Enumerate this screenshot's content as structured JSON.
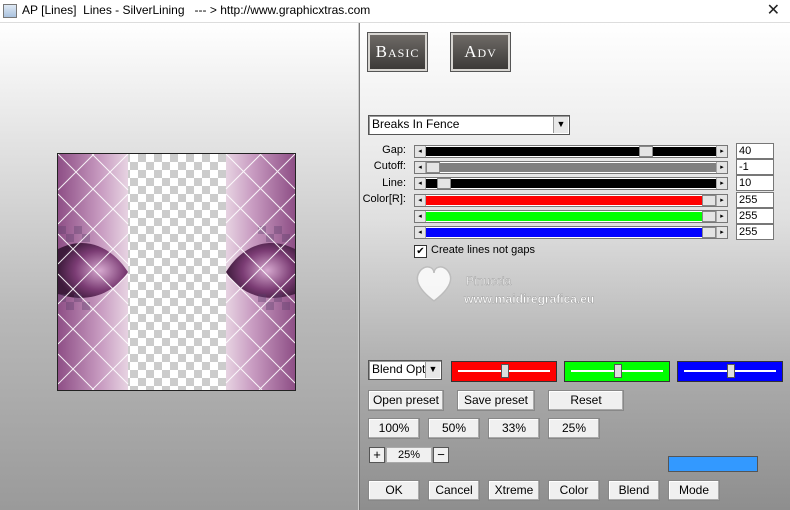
{
  "window": {
    "title": "AP [Lines]  Lines - SilverLining   --- > http://www.graphicxtras.com",
    "close_glyph": "✕"
  },
  "modes": {
    "basic": "Basic",
    "adv": "Adv"
  },
  "effect_select": {
    "value": "Breaks In Fence"
  },
  "sliders": [
    {
      "label": "Gap:",
      "value": "40",
      "fraction": 0.77,
      "fill": "#000000"
    },
    {
      "label": "Cutoff:",
      "value": "-1",
      "fraction": 0.0,
      "fill": "#808080"
    },
    {
      "label": "Line:",
      "value": "10",
      "fraction": 0.04,
      "fill": "#000000"
    },
    {
      "label": "Color[R]:",
      "value": "255",
      "fraction": 1.0,
      "fill": "#ff0000"
    },
    {
      "label": "",
      "value": "255",
      "fraction": 1.0,
      "fill": "#00ff00"
    },
    {
      "label": "",
      "value": "255",
      "fraction": 1.0,
      "fill": "#0000ff"
    }
  ],
  "checkbox": {
    "label": "Create lines not gaps",
    "checked": true,
    "mark": "✔"
  },
  "watermark": {
    "name": "Pinuccia",
    "url": "www.maidiregrafica.eu"
  },
  "blend": {
    "select_value": "Blend Optio",
    "swatches": [
      {
        "color": "#ff0000",
        "level": 0.5
      },
      {
        "color": "#00ff00",
        "level": 0.5
      },
      {
        "color": "#0000ff",
        "level": 0.5
      }
    ]
  },
  "preset_buttons": {
    "open": "Open preset",
    "save": "Save preset",
    "reset": "Reset"
  },
  "zoom_buttons": [
    "100%",
    "50%",
    "33%",
    "25%"
  ],
  "zoom": {
    "plus": "+",
    "value": "25%",
    "minus": "−"
  },
  "color_swatch": "#3399ff",
  "bottom_buttons": [
    "OK",
    "Cancel",
    "Xtreme",
    "Color",
    "Blend",
    "Mode"
  ]
}
